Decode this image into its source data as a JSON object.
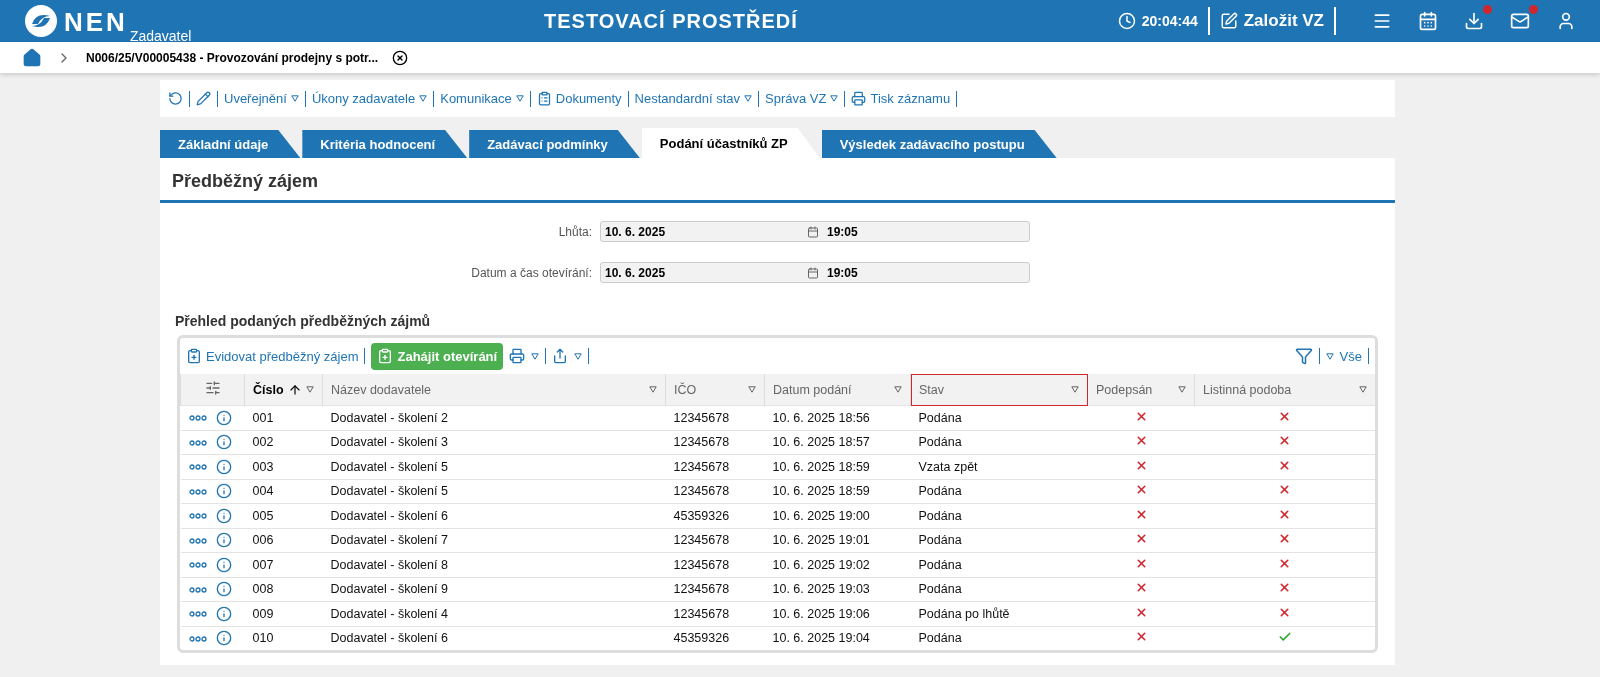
{
  "header": {
    "logo": "NEN",
    "subtitle": "Zadavatel",
    "environment": "TESTOVACÍ PROSTŘEDÍ",
    "time": "20:04:44",
    "create_button": "Založit VZ",
    "notifications": [
      {
        "kind": "menu",
        "badge": false
      },
      {
        "kind": "calendar",
        "badge": false
      },
      {
        "kind": "download",
        "badge": true
      },
      {
        "kind": "mail",
        "badge": true
      },
      {
        "kind": "user",
        "badge": false
      }
    ]
  },
  "breadcrumb": {
    "title": "N006/25/V00005438 - Provozování prodejny s potr..."
  },
  "toolbar": [
    {
      "kind": "refresh"
    },
    {
      "kind": "edit"
    },
    {
      "kind": "menu",
      "label": "Uveřejnění"
    },
    {
      "kind": "menu",
      "label": "Úkony zadavatele"
    },
    {
      "kind": "menu",
      "label": "Komunikace"
    },
    {
      "kind": "docs",
      "label": "Dokumenty"
    },
    {
      "kind": "menu",
      "label": "Nestandardní stav"
    },
    {
      "kind": "menu",
      "label": "Správa VZ"
    },
    {
      "kind": "print",
      "label": "Tisk záznamu"
    }
  ],
  "tabs": [
    {
      "label": "Základní údaje",
      "selected": false
    },
    {
      "label": "Kritéria hodnocení",
      "selected": false
    },
    {
      "label": "Zadávací podmínky",
      "selected": false
    },
    {
      "label": "Podání účastníků ZP",
      "selected": true
    },
    {
      "label": "Výsledek zadávacího postupu",
      "selected": false
    }
  ],
  "section_title": "Předběžný zájem",
  "fields": [
    {
      "label": "Lhůta:",
      "date": "10. 6. 2025",
      "time": "19:05"
    },
    {
      "label": "Datum a čas otevírání:",
      "date": "10. 6. 2025",
      "time": "19:05"
    }
  ],
  "table_title": "Přehled podaných předběžných zájmů",
  "table_toolbar": {
    "register": "Evidovat předběžný zájem",
    "open": "Zahájit otevírání",
    "filter_label": "Vše"
  },
  "table": {
    "columns": [
      {
        "label": "Číslo",
        "sorted": true,
        "highlighted": false
      },
      {
        "label": "Název dodavatele",
        "sorted": false,
        "highlighted": false
      },
      {
        "label": "IČO",
        "sorted": false,
        "highlighted": false
      },
      {
        "label": "Datum podání",
        "sorted": false,
        "highlighted": false
      },
      {
        "label": "Stav",
        "sorted": false,
        "highlighted": true
      },
      {
        "label": "Podepsán",
        "sorted": false,
        "highlighted": false
      },
      {
        "label": "Listinná podoba",
        "sorted": false,
        "highlighted": false
      }
    ],
    "rows": [
      {
        "number": "001",
        "supplier": "Dodavatel - školení 2",
        "ico": "12345678",
        "date": "10. 6. 2025 18:56",
        "status": "Podána",
        "signed": false,
        "paper": false
      },
      {
        "number": "002",
        "supplier": "Dodavatel - školení 3",
        "ico": "12345678",
        "date": "10. 6. 2025 18:57",
        "status": "Podána",
        "signed": false,
        "paper": false
      },
      {
        "number": "003",
        "supplier": "Dodavatel - školení 5",
        "ico": "12345678",
        "date": "10. 6. 2025 18:59",
        "status": "Vzata zpět",
        "signed": false,
        "paper": false
      },
      {
        "number": "004",
        "supplier": "Dodavatel - školení 5",
        "ico": "12345678",
        "date": "10. 6. 2025 18:59",
        "status": "Podána",
        "signed": false,
        "paper": false
      },
      {
        "number": "005",
        "supplier": "Dodavatel - školení 6",
        "ico": "45359326",
        "date": "10. 6. 2025 19:00",
        "status": "Podána",
        "signed": false,
        "paper": false
      },
      {
        "number": "006",
        "supplier": "Dodavatel - školení 7",
        "ico": "12345678",
        "date": "10. 6. 2025 19:01",
        "status": "Podána",
        "signed": false,
        "paper": false
      },
      {
        "number": "007",
        "supplier": "Dodavatel - školení 8",
        "ico": "12345678",
        "date": "10. 6. 2025 19:02",
        "status": "Podána",
        "signed": false,
        "paper": false
      },
      {
        "number": "008",
        "supplier": "Dodavatel - školení 9",
        "ico": "12345678",
        "date": "10. 6. 2025 19:03",
        "status": "Podána",
        "signed": false,
        "paper": false
      },
      {
        "number": "009",
        "supplier": "Dodavatel - školení 4",
        "ico": "12345678",
        "date": "10. 6. 2025 19:06",
        "status": "Podána po lhůtě",
        "signed": false,
        "paper": false
      },
      {
        "number": "010",
        "supplier": "Dodavatel - školení 6",
        "ico": "45359326",
        "date": "10. 6. 2025 19:04",
        "status": "Podána",
        "signed": false,
        "paper": true
      }
    ]
  }
}
